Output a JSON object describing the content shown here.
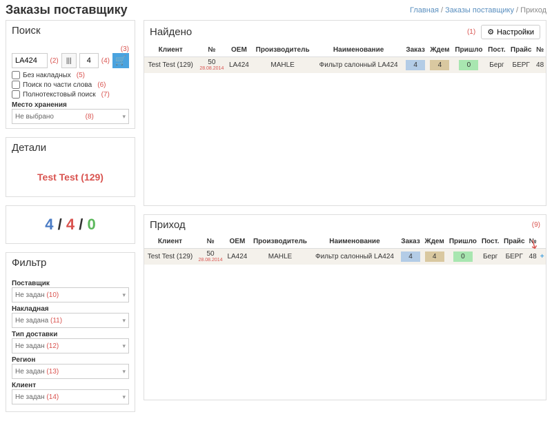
{
  "header": {
    "title": "Заказы поставщику",
    "breadcrumb": {
      "home": "Главная",
      "orders": "Заказы поставщику",
      "current": "Приход"
    }
  },
  "search": {
    "title": "Поиск",
    "input_value": "LA424",
    "ann2": "(2)",
    "ann3": "(3)",
    "qty_value": "4",
    "ann4": "(4)",
    "chk_no_invoices": "Без накладных",
    "ann5": "(5)",
    "chk_partial": "Поиск по части слова",
    "ann6": "(6)",
    "chk_fulltext": "Полнотекстовый поиск",
    "ann7": "(7)",
    "storage_label": "Место хранения",
    "storage_value": "Не выбрано",
    "ann8": "(8)"
  },
  "details": {
    "title": "Детали",
    "client": "Test Test (129)",
    "count_blue": "4",
    "count_red": "4",
    "count_green": "0",
    "sep": " / "
  },
  "filter": {
    "title": "Фильтр",
    "supplier_label": "Поставщик",
    "supplier_value": "Не задан",
    "ann10": "(10)",
    "invoice_label": "Накладная",
    "invoice_value": "Не задана",
    "ann11": "(11)",
    "delivery_label": "Тип доставки",
    "delivery_value": "Не задан",
    "ann12": "(12)",
    "region_label": "Регион",
    "region_value": "Не задан",
    "ann13": "(13)",
    "client_label": "Клиент",
    "client_value": "Не задан",
    "ann14": "(14)"
  },
  "found": {
    "title": "Найдено",
    "ann1": "(1)",
    "settings": "Настройки",
    "cols": {
      "client": "Клиент",
      "num": "№",
      "oem": "ОЕМ",
      "manuf": "Производитель",
      "name": "Наименование",
      "order": "Заказ",
      "wait": "Ждем",
      "arrived": "Пришло",
      "supp": "Пост.",
      "price": "Прайс",
      "n2": "№"
    },
    "row": {
      "client": "Test Test (129)",
      "num_top": "50",
      "num_bot": "28.08.2014",
      "oem": "LA424",
      "manuf": "MAHLE",
      "name": "Фильтр салонный LA424",
      "order": "4",
      "wait": "4",
      "arrived": "0",
      "supp": "Берг",
      "price": "БЕРГ",
      "n2": "48"
    }
  },
  "incoming": {
    "title": "Приход",
    "ann9": "(9)",
    "cols": {
      "client": "Клиент",
      "num": "№",
      "oem": "ОЕМ",
      "manuf": "Производитель",
      "name": "Наименование",
      "order": "Заказ",
      "wait": "Ждем",
      "arrived": "Пришло",
      "supp": "Пост.",
      "price": "Прайс",
      "n2": "№"
    },
    "row": {
      "client": "Test Test (129)",
      "num_top": "50",
      "num_bot": "28.08.2014",
      "oem": "LA424",
      "manuf": "MAHLE",
      "name": "Фильтр салонный LA424",
      "order": "4",
      "wait": "4",
      "arrived": "0",
      "supp": "Берг",
      "price": "БЕРГ",
      "n2": "48"
    }
  }
}
